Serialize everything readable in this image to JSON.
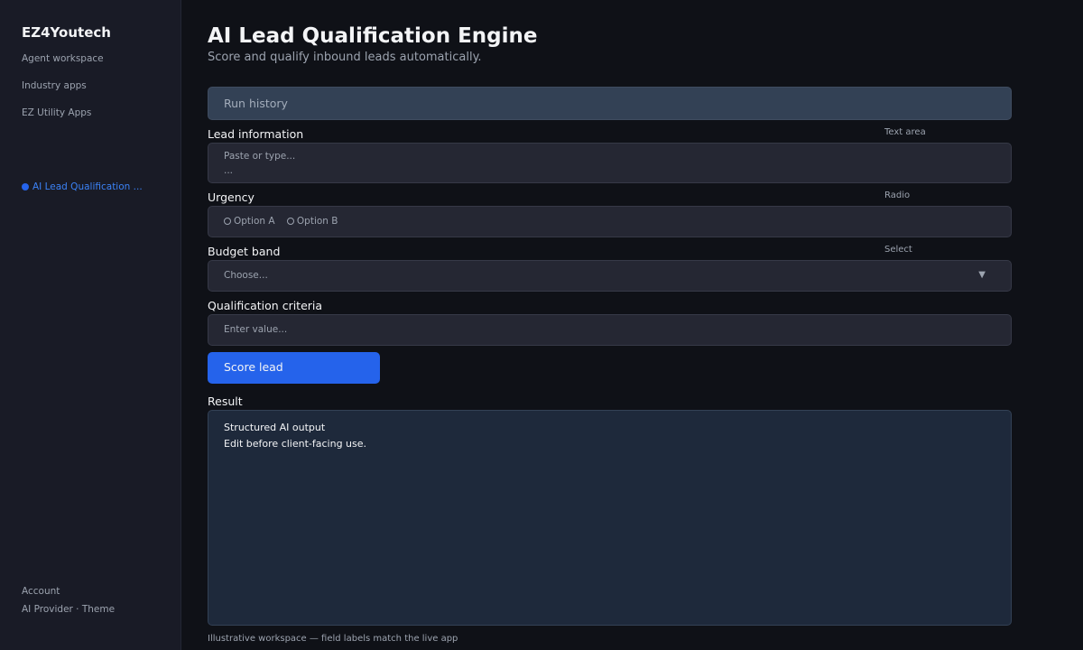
{
  "sidebar": {
    "brand": "EZ4Youtech",
    "nav": [
      "Agent workspace",
      "Industry apps",
      "EZ Utility Apps"
    ],
    "active_item": "AI Lead Qualification ...",
    "footer": {
      "account": "Account",
      "provider_theme": "AI Provider · Theme"
    }
  },
  "header": {
    "title": "AI Lead Qualification Engine",
    "subtitle": "Score and qualify inbound leads automatically."
  },
  "run_history": {
    "label": "Run history"
  },
  "fields": {
    "lead_info": {
      "label": "Lead information",
      "type": "Text area",
      "placeholder": "Paste or type...",
      "ellipsis": "..."
    },
    "urgency": {
      "label": "Urgency",
      "type": "Radio",
      "options": [
        "Option A",
        "Option B"
      ]
    },
    "budget": {
      "label": "Budget band",
      "type": "Select",
      "placeholder": "Choose...",
      "chevron": "▼"
    },
    "criteria": {
      "label": "Qualification criteria",
      "placeholder": "Enter value..."
    }
  },
  "action": {
    "score_label": "Score lead"
  },
  "result": {
    "label": "Result",
    "lines": [
      "Structured AI output",
      "Edit before client-facing use."
    ]
  },
  "note": "Illustrative workspace — field labels match the live app",
  "colors": {
    "background": "#0f1117",
    "sidebar": "#191b26",
    "accent": "#2563eb",
    "result_bg": "#1e293b"
  }
}
